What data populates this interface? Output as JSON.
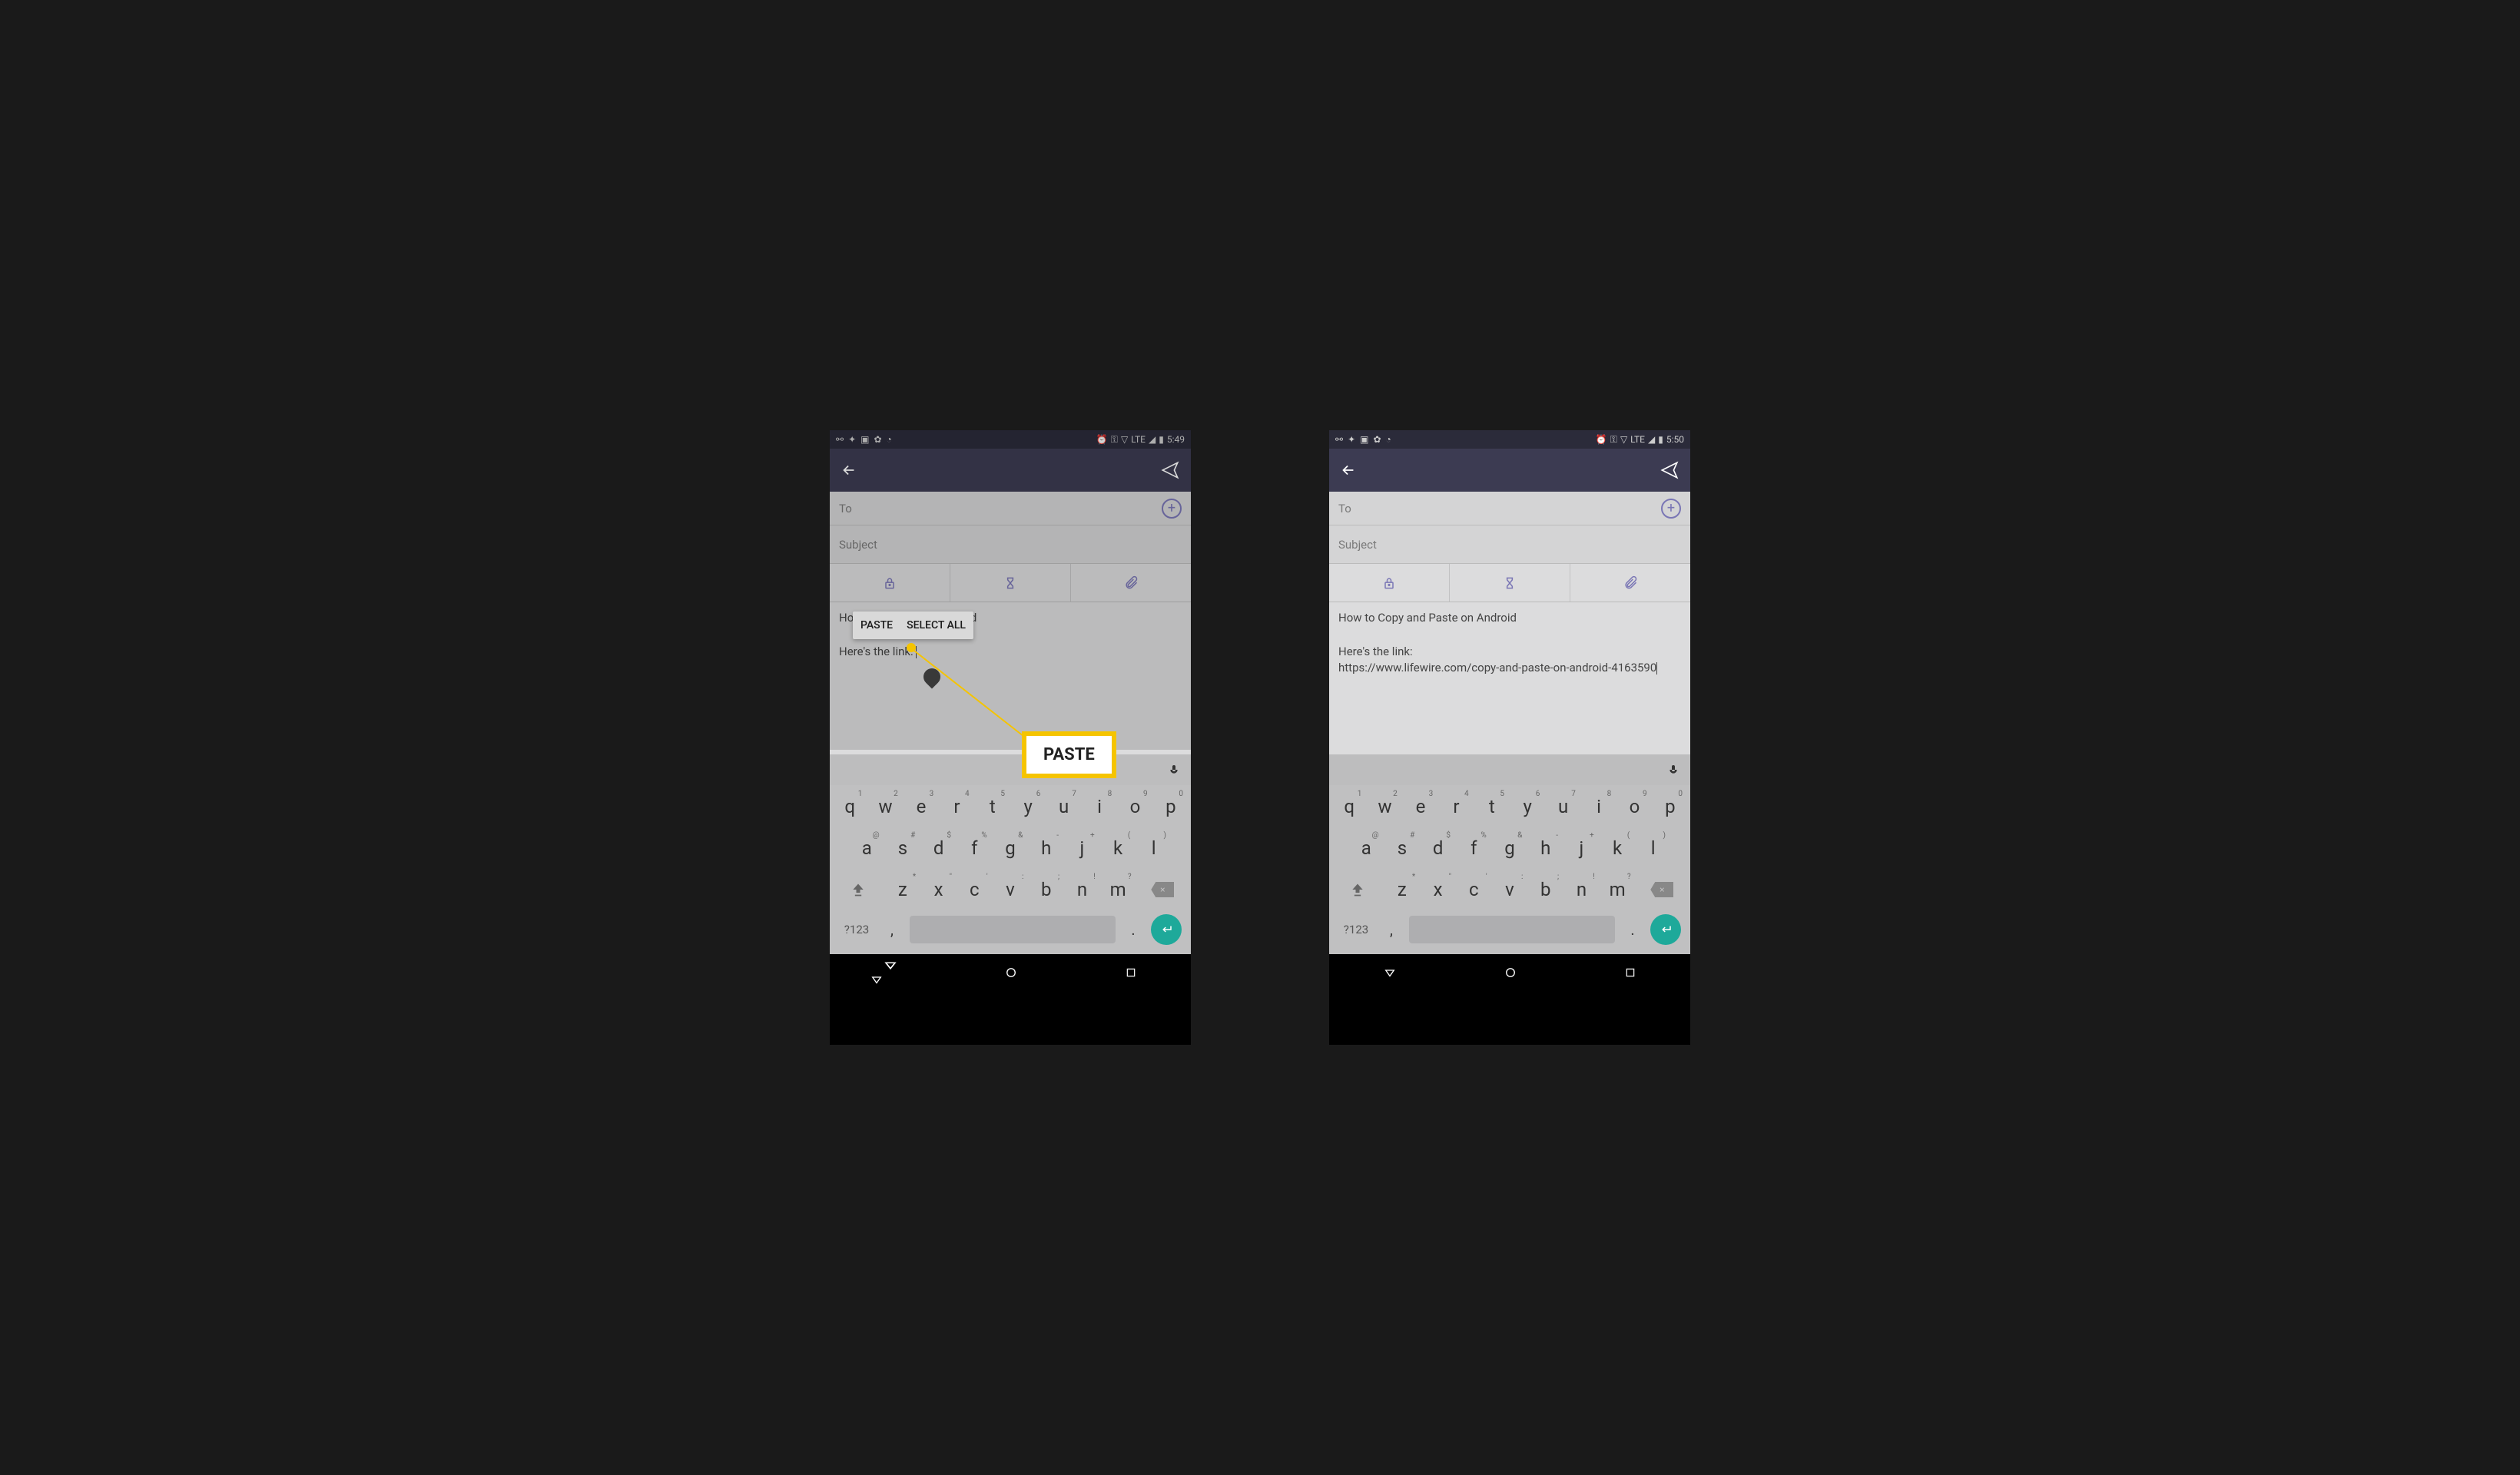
{
  "screens": [
    {
      "status": {
        "time": "5:49",
        "network": "LTE"
      },
      "compose": {
        "to_label": "To",
        "subject_label": "Subject",
        "body_line1": "Ho                             Android",
        "body_line2": "Here's the link: "
      },
      "context_menu": {
        "paste": "PASTE",
        "select_all": "SELECT ALL"
      },
      "callout": "PASTE"
    },
    {
      "status": {
        "time": "5:50",
        "network": "LTE"
      },
      "compose": {
        "to_label": "To",
        "subject_label": "Subject",
        "body_line1": "How to Copy and Paste on Android",
        "body_line2": "Here's the link:",
        "body_line3": "https://www.lifewire.com/copy-and-paste-on-android-4163590"
      }
    }
  ],
  "keyboard": {
    "row1": [
      {
        "k": "q",
        "s": "1"
      },
      {
        "k": "w",
        "s": "2"
      },
      {
        "k": "e",
        "s": "3"
      },
      {
        "k": "r",
        "s": "4"
      },
      {
        "k": "t",
        "s": "5"
      },
      {
        "k": "y",
        "s": "6"
      },
      {
        "k": "u",
        "s": "7"
      },
      {
        "k": "i",
        "s": "8"
      },
      {
        "k": "o",
        "s": "9"
      },
      {
        "k": "p",
        "s": "0"
      }
    ],
    "row2": [
      {
        "k": "a",
        "s": "@"
      },
      {
        "k": "s",
        "s": "#"
      },
      {
        "k": "d",
        "s": "$"
      },
      {
        "k": "f",
        "s": "%"
      },
      {
        "k": "g",
        "s": "&"
      },
      {
        "k": "h",
        "s": "-"
      },
      {
        "k": "j",
        "s": "+"
      },
      {
        "k": "k",
        "s": "("
      },
      {
        "k": "l",
        "s": ")"
      }
    ],
    "row3": [
      {
        "k": "z",
        "s": "*"
      },
      {
        "k": "x",
        "s": "\""
      },
      {
        "k": "c",
        "s": "'"
      },
      {
        "k": "v",
        "s": ":"
      },
      {
        "k": "b",
        "s": ";"
      },
      {
        "k": "n",
        "s": "!"
      },
      {
        "k": "m",
        "s": "?"
      }
    ],
    "sym": "?123"
  }
}
